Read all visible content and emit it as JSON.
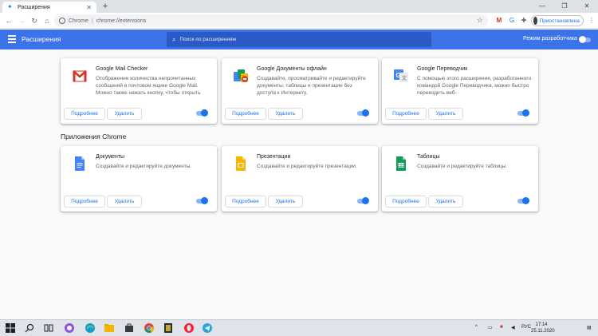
{
  "browser": {
    "tab_title": "Расширения",
    "address_site": "Chrome",
    "address_url": "chrome://extensions",
    "profile_status": "Приостановлена"
  },
  "header": {
    "title": "Расширения",
    "search_placeholder": "Поиск по расширениям",
    "dev_mode_label": "Режим разработчика"
  },
  "extensions": [
    {
      "name": "Google Mail Checker",
      "description": "Отображение количества непрочитанных сообщений в почтовом ящике Google Mail. Можно также нажать кнопку, чтобы открыть",
      "details_label": "Подробнее",
      "remove_label": "Удалить",
      "icon": "gmail-icon",
      "enabled": true
    },
    {
      "name": "Google Документы офлайн",
      "description": "Создавайте, просматривайте и редактируйте документы, таблицы и презентации без доступа к Интернету.",
      "details_label": "Подробнее",
      "remove_label": "Удалить",
      "icon": "docs-offline-icon",
      "enabled": true
    },
    {
      "name": "Google Переводчик",
      "description": "С помощью этого расширения, разработанного командой Google Переводчика, можно быстро переводить веб-",
      "details_label": "Подробнее",
      "remove_label": "Удалить",
      "icon": "google-translate-icon",
      "enabled": true
    }
  ],
  "apps_section_title": "Приложения Chrome",
  "apps": [
    {
      "name": "Документы",
      "description": "Создавайте и редактируйте документы.",
      "details_label": "Подробнее",
      "remove_label": "Удалить",
      "icon": "docs-icon",
      "enabled": true
    },
    {
      "name": "Презентации",
      "description": "Создавайте и редактируйте презентации.",
      "details_label": "Подробнее",
      "remove_label": "Удалить",
      "icon": "slides-icon",
      "enabled": true
    },
    {
      "name": "Таблицы",
      "description": "Создавайте и редактируйте таблицы.",
      "details_label": "Подробнее",
      "remove_label": "Удалить",
      "icon": "sheets-icon",
      "enabled": true
    }
  ],
  "taskbar": {
    "language": "РУС",
    "time": "17:14",
    "date": "25.11.2020"
  },
  "colors": {
    "header_blue": "#3c73e8",
    "accent": "#1a73e8"
  }
}
